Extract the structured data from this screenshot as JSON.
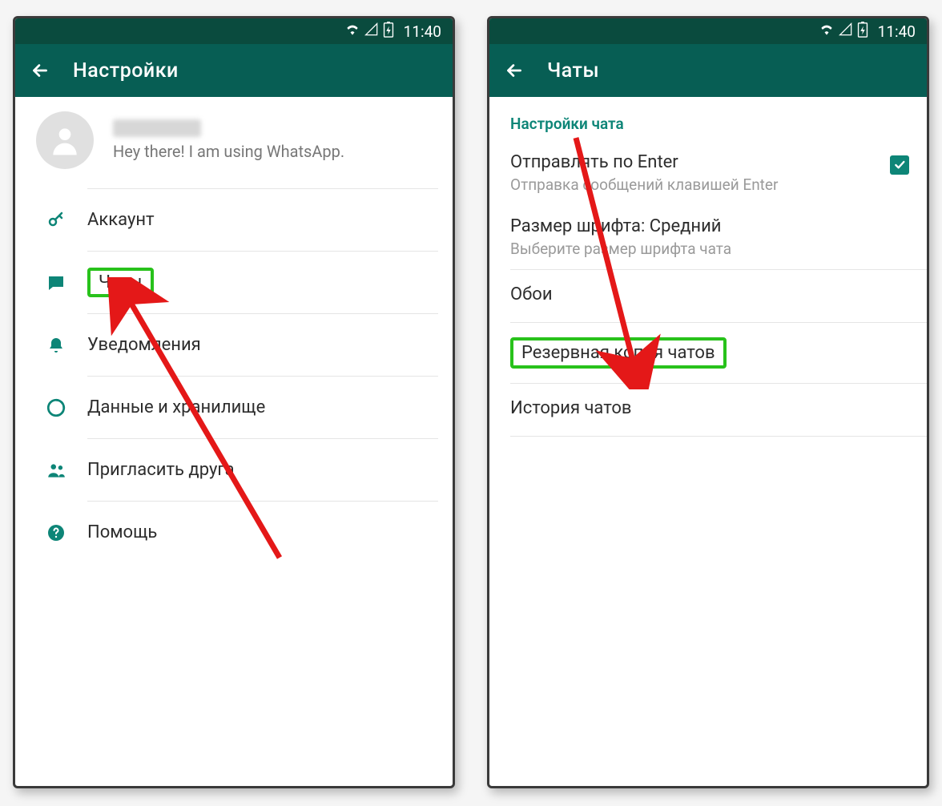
{
  "status": {
    "time": "11:40"
  },
  "left": {
    "title": "Настройки",
    "profile_status": "Hey there! I am using WhatsApp.",
    "items": {
      "account": "Аккаунт",
      "chats": "Чаты",
      "notifications": "Уведомления",
      "data": "Данные и хранилище",
      "invite": "Пригласить друга",
      "help": "Помощь"
    }
  },
  "right": {
    "title": "Чаты",
    "section": "Настройки чата",
    "enter": {
      "primary": "Отправлять по Enter",
      "secondary": "Отправка сообщений клавишей Enter"
    },
    "font": {
      "primary": "Размер шрифта: Средний",
      "secondary": "Выберите размер шрифта чата"
    },
    "wallpaper": "Обои",
    "backup": "Резервная копия чатов",
    "history": "История чатов"
  }
}
